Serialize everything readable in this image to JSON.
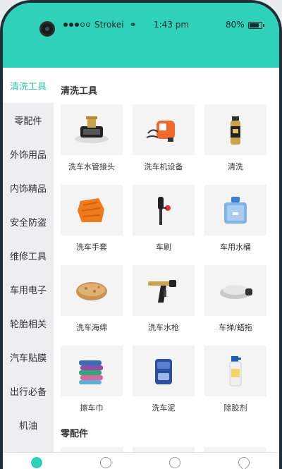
{
  "status": {
    "carrier": "Strokei",
    "time": "1:43 pm",
    "battery": "80%"
  },
  "sidebar": {
    "items": [
      {
        "label": "清洗工具",
        "active": true
      },
      {
        "label": "零配件"
      },
      {
        "label": "外饰用品"
      },
      {
        "label": "内饰精品"
      },
      {
        "label": "安全防盗"
      },
      {
        "label": "维修工具"
      },
      {
        "label": "车用电子"
      },
      {
        "label": "轮胎相关"
      },
      {
        "label": "汽车贴膜"
      },
      {
        "label": "出行必备"
      },
      {
        "label": "机油"
      }
    ]
  },
  "content": {
    "section1_title": "清洗工具",
    "section2_title": "零配件",
    "products": [
      {
        "label": "洗车水管接头",
        "icon": "hose-connector-icon"
      },
      {
        "label": "洗车机设备",
        "icon": "washer-machine-icon"
      },
      {
        "label": "清洗",
        "icon": "spray-can-icon"
      },
      {
        "label": "洗车手套",
        "icon": "wash-glove-icon"
      },
      {
        "label": "车刷",
        "icon": "car-brush-icon"
      },
      {
        "label": "车用水桶",
        "icon": "water-bucket-icon"
      },
      {
        "label": "洗车海绵",
        "icon": "sponge-icon"
      },
      {
        "label": "洗车水枪",
        "icon": "water-gun-icon"
      },
      {
        "label": "车掸/蜡拖",
        "icon": "duster-icon"
      },
      {
        "label": "擦车巾",
        "icon": "towel-icon"
      },
      {
        "label": "洗车泥",
        "icon": "clay-bar-icon"
      },
      {
        "label": "除胶剂",
        "icon": "adhesive-remover-icon"
      }
    ]
  },
  "colors": {
    "accent": "#2fd1b8",
    "active_text": "#2fc3ad"
  }
}
